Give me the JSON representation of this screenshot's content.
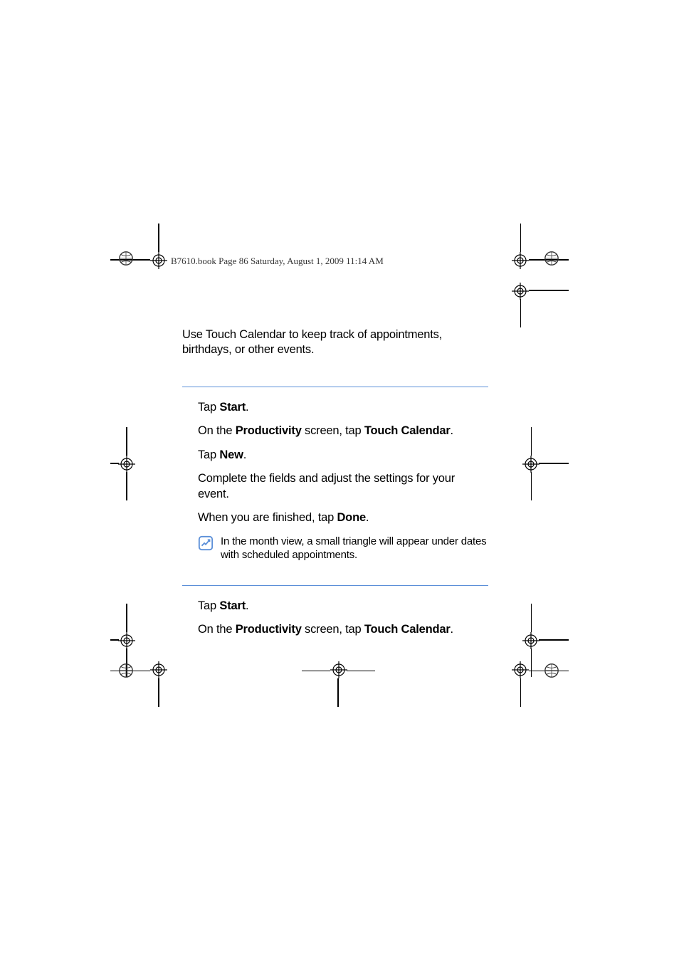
{
  "header": "B7610.book  Page 86  Saturday, August 1, 2009  11:14 AM",
  "intro": "Use Touch Calendar to keep track of appointments, birthdays, or other events.",
  "section1": {
    "step1_pre": "Tap ",
    "step1_bold": "Start",
    "step1_post": ".",
    "step2_pre": "On the ",
    "step2_bold1": "Productivity",
    "step2_mid": " screen, tap ",
    "step2_bold2": "Touch Calendar",
    "step2_post": ".",
    "step3_pre": "Tap ",
    "step3_bold": "New",
    "step3_post": ".",
    "step4": "Complete the fields and adjust the settings for your event.",
    "step5_pre": "When you are finished, tap ",
    "step5_bold": "Done",
    "step5_post": ".",
    "note": "In the month view, a small triangle will appear under dates with scheduled appointments."
  },
  "section2": {
    "step1_pre": "Tap ",
    "step1_bold": "Start",
    "step1_post": ".",
    "step2_pre": "On the ",
    "step2_bold1": "Productivity",
    "step2_mid": " screen, tap ",
    "step2_bold2": "Touch Calendar",
    "step2_post": "."
  }
}
